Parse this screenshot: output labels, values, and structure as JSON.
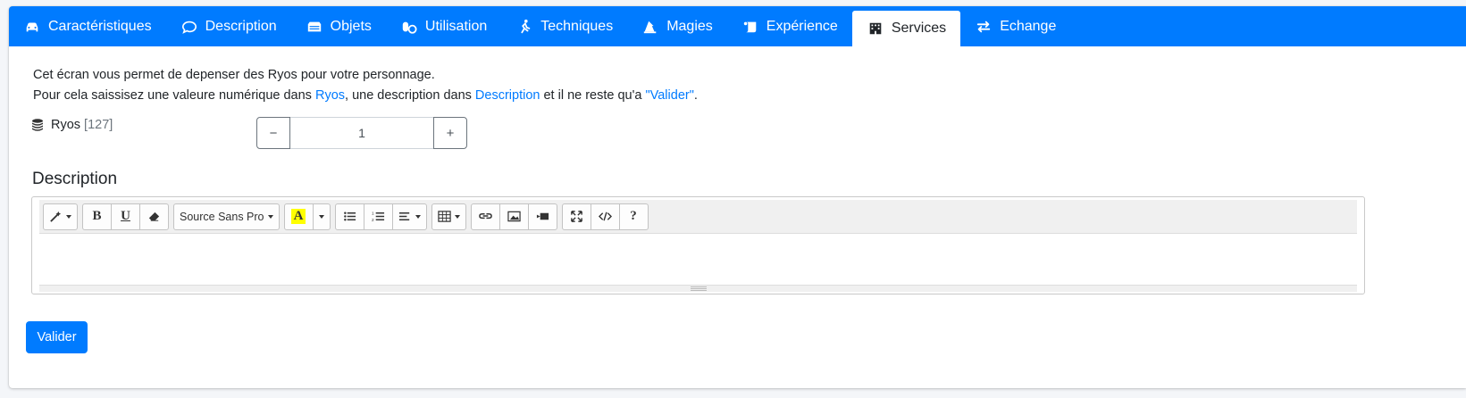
{
  "tabs": [
    {
      "label": "Caractéristiques",
      "icon": "car-icon"
    },
    {
      "label": "Description",
      "icon": "comment-icon"
    },
    {
      "label": "Objets",
      "icon": "box-icon"
    },
    {
      "label": "Utilisation",
      "icon": "pills-icon"
    },
    {
      "label": "Techniques",
      "icon": "running-icon"
    },
    {
      "label": "Magies",
      "icon": "hat-wizard-icon"
    },
    {
      "label": "Expérience",
      "icon": "scroll-icon"
    },
    {
      "label": "Services",
      "icon": "building-icon",
      "active": true
    },
    {
      "label": "Echange",
      "icon": "exchange-icon"
    }
  ],
  "intro": {
    "line1": "Cet écran vous permet de depenser des Ryos pour votre personnage.",
    "line2_a": "Pour cela saissisez une valeure numérique dans ",
    "line2_link1": "Ryos",
    "line2_b": ", une description dans ",
    "line2_link2": "Description",
    "line2_c": " et il ne reste qu'a ",
    "line2_link3": "\"Valider\"",
    "line2_d": "."
  },
  "ryos": {
    "label": "Ryos",
    "count": "[127]",
    "value": "1",
    "minus_label": "−",
    "plus_label": "+"
  },
  "description": {
    "title": "Description",
    "font_select": "Source Sans Pro",
    "bold_label": "B",
    "underline_label": "U",
    "highlight_label": "A",
    "help_label": "?"
  },
  "submit_label": "Valider",
  "colors": {
    "primary": "#007bff",
    "highlight": "#ffff00"
  }
}
